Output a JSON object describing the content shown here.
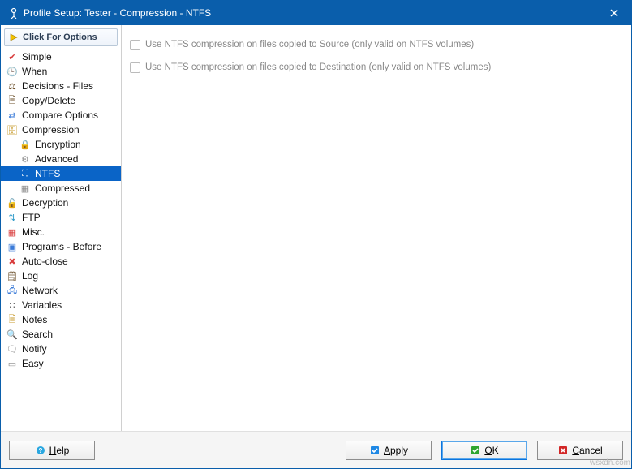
{
  "window": {
    "title": "Profile Setup: Tester - Compression - NTFS"
  },
  "toolbar": {
    "options_label": "Click For Options"
  },
  "tree": [
    {
      "id": "simple",
      "label": "Simple",
      "icon": "✔",
      "iconColor": "#d83b3b",
      "child": false,
      "selected": false
    },
    {
      "id": "when",
      "label": "When",
      "icon": "🕒",
      "iconColor": "#3b7bd8",
      "child": false,
      "selected": false
    },
    {
      "id": "decisions-files",
      "label": "Decisions - Files",
      "icon": "⚖",
      "iconColor": "#6b4f2a",
      "child": false,
      "selected": false
    },
    {
      "id": "copy-delete",
      "label": "Copy/Delete",
      "icon": "🗎",
      "iconColor": "#6b4f2a",
      "child": false,
      "selected": false
    },
    {
      "id": "compare-options",
      "label": "Compare Options",
      "icon": "⇄",
      "iconColor": "#3b7bd8",
      "child": false,
      "selected": false
    },
    {
      "id": "compression",
      "label": "Compression",
      "icon": "🗄",
      "iconColor": "#c79a2b",
      "child": false,
      "selected": false
    },
    {
      "id": "encryption",
      "label": "Encryption",
      "icon": "🔒",
      "iconColor": "#c79a2b",
      "child": true,
      "selected": false
    },
    {
      "id": "advanced",
      "label": "Advanced",
      "icon": "⚙",
      "iconColor": "#888",
      "child": true,
      "selected": false
    },
    {
      "id": "ntfs",
      "label": "NTFS",
      "icon": "⛶",
      "iconColor": "#fff",
      "child": true,
      "selected": true
    },
    {
      "id": "compressed",
      "label": "Compressed",
      "icon": "▦",
      "iconColor": "#888",
      "child": true,
      "selected": false
    },
    {
      "id": "decryption",
      "label": "Decryption",
      "icon": "🔓",
      "iconColor": "#c79a2b",
      "child": false,
      "selected": false
    },
    {
      "id": "ftp",
      "label": "FTP",
      "icon": "⇅",
      "iconColor": "#2a98c7",
      "child": false,
      "selected": false
    },
    {
      "id": "misc",
      "label": "Misc.",
      "icon": "▦",
      "iconColor": "#d83b3b",
      "child": false,
      "selected": false
    },
    {
      "id": "programs-before",
      "label": "Programs - Before",
      "icon": "▣",
      "iconColor": "#3b7bd8",
      "child": false,
      "selected": false
    },
    {
      "id": "auto-close",
      "label": "Auto-close",
      "icon": "✖",
      "iconColor": "#d83b3b",
      "child": false,
      "selected": false
    },
    {
      "id": "log",
      "label": "Log",
      "icon": "🗒",
      "iconColor": "#6b4f2a",
      "child": false,
      "selected": false
    },
    {
      "id": "network",
      "label": "Network",
      "icon": "🖧",
      "iconColor": "#3b7bd8",
      "child": false,
      "selected": false
    },
    {
      "id": "variables",
      "label": "Variables",
      "icon": "∷",
      "iconColor": "#555",
      "child": false,
      "selected": false
    },
    {
      "id": "notes",
      "label": "Notes",
      "icon": "🗎",
      "iconColor": "#c79a2b",
      "child": false,
      "selected": false
    },
    {
      "id": "search",
      "label": "Search",
      "icon": "🔍",
      "iconColor": "#2a7b2a",
      "child": false,
      "selected": false
    },
    {
      "id": "notify",
      "label": "Notify",
      "icon": "🗨",
      "iconColor": "#888",
      "child": false,
      "selected": false
    },
    {
      "id": "easy",
      "label": "Easy",
      "icon": "▭",
      "iconColor": "#888",
      "child": false,
      "selected": false
    }
  ],
  "main": {
    "checkbox1": "Use NTFS compression on files copied to Source (only valid on NTFS volumes)",
    "checkbox2": "Use NTFS compression on files copied to Destination (only valid on NTFS volumes)"
  },
  "buttons": {
    "help": "Help",
    "apply": "Apply",
    "ok": "OK",
    "cancel": "Cancel"
  },
  "watermark": "wsxdn.com"
}
